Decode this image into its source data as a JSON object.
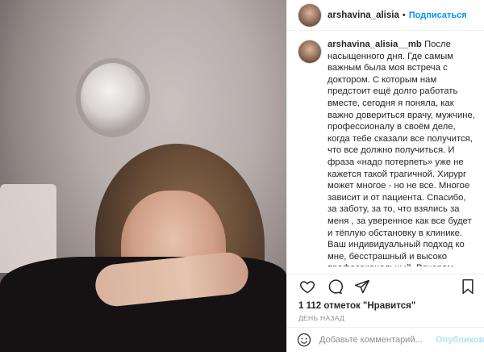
{
  "post": {
    "username": "arshavina_alisia",
    "separator": "•",
    "follow_label": "Подписаться",
    "caption_author": "arshavina_alisia__mb",
    "caption_text": "После насыщенного дня. Где самым важным была моя встреча с доктором. С которым нам предстоит ещё долго работать вместе, сегодня я поняла, как важно довериться врачу, мужчине, профессионалу в своём деле, когда тебе сказали все получится, что все должно получиться. И фраза «надо потерпеть» уже не кажется такой трагичной. Хирург может многое - но не все. Многое зависит и от пациента. Спасибо, за заботу, за то, что взялись за меня , за уверенное как все будет и тёплую обстановку в клинике. Ваш индивидуальный подход ко мне, бесстрашный и высоко профессиональный. Вечером поняла, что столько людей писало здесь и желало всего хорошо, что",
    "likes": "1 112 отметок \"Нравится\"",
    "timestamp": "ДЕНЬ НАЗАД",
    "comment_placeholder": "Добавьте комментарий...",
    "publish_label": "Опубликовать"
  },
  "icons": {
    "like": "heart-icon",
    "comment": "comment-icon",
    "share": "share-icon",
    "save": "bookmark-icon",
    "emoji": "emoji-icon"
  },
  "colors": {
    "link": "#0095f6",
    "publish_disabled": "#b2dffc",
    "muted": "#8e8e8e"
  }
}
